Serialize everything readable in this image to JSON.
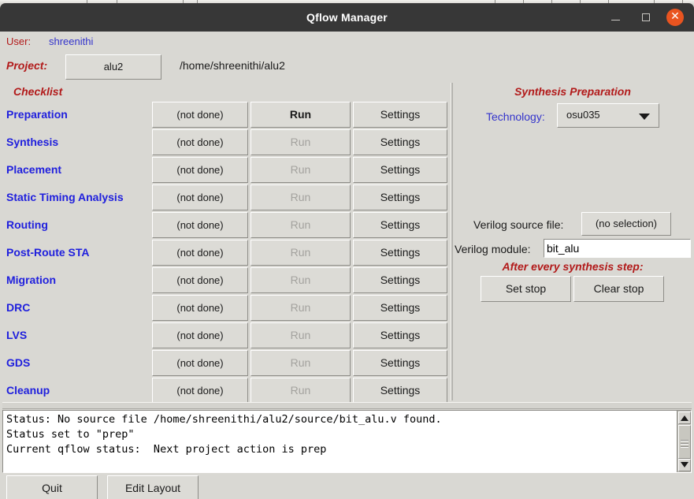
{
  "window": {
    "title": "Qflow Manager",
    "minimize_label": "–",
    "maximize_label": "□",
    "close_label": "✕"
  },
  "header": {
    "user_label": "User:",
    "user_value": "shreenithi",
    "project_label": "Project:",
    "project_button": "alu2",
    "project_path": "/home/shreenithi/alu2"
  },
  "checklist": {
    "title": "Checklist",
    "run_label": "Run",
    "settings_label": "Settings",
    "not_done_label": "(not done)",
    "rows": [
      {
        "label": "Preparation",
        "status": "(not done)",
        "run": "Run",
        "settings": "Settings",
        "run_enabled": true
      },
      {
        "label": "Synthesis",
        "status": "(not done)",
        "run": "Run",
        "settings": "Settings",
        "run_enabled": false
      },
      {
        "label": "Placement",
        "status": "(not done)",
        "run": "Run",
        "settings": "Settings",
        "run_enabled": false
      },
      {
        "label": "Static Timing Analysis",
        "status": "(not done)",
        "run": "Run",
        "settings": "Settings",
        "run_enabled": false
      },
      {
        "label": "Routing",
        "status": "(not done)",
        "run": "Run",
        "settings": "Settings",
        "run_enabled": false
      },
      {
        "label": "Post-Route STA",
        "status": "(not done)",
        "run": "Run",
        "settings": "Settings",
        "run_enabled": false
      },
      {
        "label": "Migration",
        "status": "(not done)",
        "run": "Run",
        "settings": "Settings",
        "run_enabled": false
      },
      {
        "label": "DRC",
        "status": "(not done)",
        "run": "Run",
        "settings": "Settings",
        "run_enabled": false
      },
      {
        "label": "LVS",
        "status": "(not done)",
        "run": "Run",
        "settings": "Settings",
        "run_enabled": false
      },
      {
        "label": "GDS",
        "status": "(not done)",
        "run": "Run",
        "settings": "Settings",
        "run_enabled": false
      },
      {
        "label": "Cleanup",
        "status": "(not done)",
        "run": "Run",
        "settings": "Settings",
        "run_enabled": false
      }
    ]
  },
  "synthesis": {
    "title": "Synthesis Preparation",
    "technology_label": "Technology:",
    "technology_value": "osu035",
    "technology_options": [
      "osu035"
    ],
    "verilog_source_label": "Verilog source file:",
    "verilog_source_value": "(no selection)",
    "verilog_module_label": "Verilog module:",
    "verilog_module_value": "bit_alu",
    "after_step_title": "After every synthesis step:",
    "set_stop_label": "Set stop",
    "clear_stop_label": "Clear stop"
  },
  "status": {
    "lines": [
      "Status: No source file /home/shreenithi/alu2/source/bit_alu.v found.",
      "Status set to \"prep\"",
      "Current qflow status:  Next project action is prep"
    ],
    "text": "Status: No source file /home/shreenithi/alu2/source/bit_alu.v found.\nStatus set to \"prep\"\nCurrent qflow status:  Next project action is prep"
  },
  "footer": {
    "quit_label": "Quit",
    "edit_layout_label": "Edit Layout"
  },
  "colors": {
    "titlebar": "#373737",
    "close_button": "#e95420",
    "window_background": "#d9d8d3",
    "heading_red": "#b21a1a",
    "link_blue": "#2020dd",
    "label_blue": "#3333cc",
    "disabled_text": "#a3a29e"
  }
}
